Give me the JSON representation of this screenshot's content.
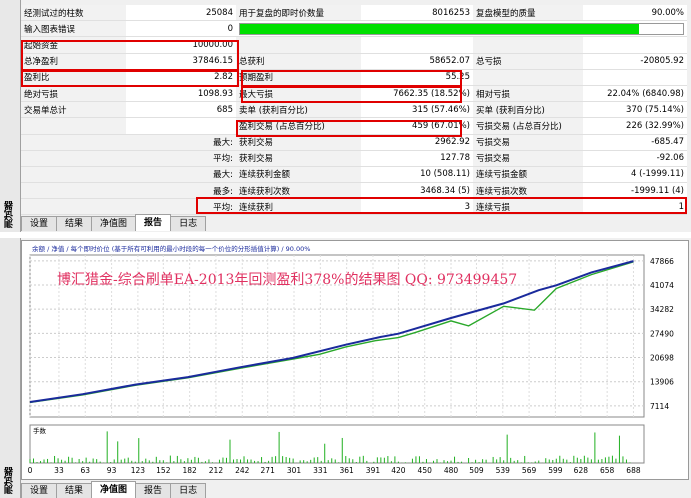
{
  "report": {
    "rows": [
      [
        "经测试过的柱数",
        "25084",
        "用于复盘的即时价数量",
        "8016253",
        "复盘模型的质量",
        "90.00%"
      ],
      [
        "输入图表错误",
        "0",
        "",
        "",
        "",
        ""
      ],
      [
        "起始资金",
        "10000.00",
        "",
        "",
        "",
        ""
      ],
      [
        "总净盈利",
        "37846.15",
        "总获利",
        "58652.07",
        "总亏损",
        "-20805.92"
      ],
      [
        "盈利比",
        "2.82",
        "预期盈利",
        "55.25",
        "",
        ""
      ],
      [
        "绝对亏损",
        "1098.93",
        "最大亏损",
        "7662.35 (18.52%)",
        "相对亏损",
        "22.04% (6840.98)"
      ],
      [
        "交易单总计",
        "685",
        "卖单 (获利百分比)",
        "315 (57.46%)",
        "买单 (获利百分比)",
        "370 (75.14%)"
      ],
      [
        "",
        "",
        "盈利交易 (占总百分比)",
        "459 (67.01%)",
        "亏损交易 (占总百分比)",
        "226 (32.99%)"
      ],
      [
        "",
        "最大:",
        "获利交易",
        "2962.92",
        "亏损交易",
        "-685.47"
      ],
      [
        "",
        "平均:",
        "获利交易",
        "127.78",
        "亏损交易",
        "-92.06"
      ],
      [
        "",
        "最大:",
        "连续获利金额",
        "10 (508.11)",
        "连续亏损金额",
        "4 (-1999.11)"
      ],
      [
        "",
        "最多:",
        "连续获利次数",
        "3468.34 (5)",
        "连续亏损次数",
        "-1999.11 (4)"
      ],
      [
        "",
        "平均:",
        "连续获利",
        "3",
        "连续亏损",
        "1"
      ]
    ],
    "quality_fraction": 0.9
  },
  "sidebar_label": "测试器",
  "tabs_top": [
    {
      "label": "设置",
      "active": false
    },
    {
      "label": "结果",
      "active": false
    },
    {
      "label": "净值图",
      "active": false
    },
    {
      "label": "报告",
      "active": true
    },
    {
      "label": "日志",
      "active": false
    }
  ],
  "tabs_bottom": [
    {
      "label": "设置",
      "active": false
    },
    {
      "label": "结果",
      "active": false
    },
    {
      "label": "净值图",
      "active": true
    },
    {
      "label": "报告",
      "active": false
    },
    {
      "label": "日志",
      "active": false
    }
  ],
  "chart_header": "余额 / 净值 / 每个即时价位 (基于所有可利用的最小时段的每一个价位的分形插值计算) / 90.00%",
  "overlay_title": "博汇猎金-综合刷单EA-2013年回测盈利378%的结果图   QQ: 973499457",
  "volume_label": "手数",
  "colors": {
    "balance": "#1a2a9c",
    "equity": "#2aa82a",
    "volume": "#20b020",
    "highlight": "#e00000",
    "quality": "#00e000"
  },
  "chart_data": {
    "type": "line",
    "y_ticks": [
      7114,
      13906,
      20698,
      27490,
      34282,
      41074,
      47866
    ],
    "x_ticks": [
      0,
      33,
      63,
      93,
      123,
      152,
      182,
      212,
      242,
      271,
      301,
      331,
      361,
      391,
      420,
      450,
      480,
      509,
      539,
      569,
      599,
      628,
      658,
      688
    ],
    "ylim": [
      4000,
      49500
    ],
    "xlim": [
      0,
      700
    ],
    "series": [
      {
        "name": "余额",
        "values": [
          [
            0,
            8200
          ],
          [
            60,
            10400
          ],
          [
            120,
            13100
          ],
          [
            180,
            15200
          ],
          [
            240,
            18000
          ],
          [
            300,
            20600
          ],
          [
            360,
            24300
          ],
          [
            400,
            26500
          ],
          [
            420,
            27400
          ],
          [
            480,
            31800
          ],
          [
            540,
            35900
          ],
          [
            580,
            39600
          ],
          [
            600,
            41000
          ],
          [
            640,
            44600
          ],
          [
            688,
            47800
          ]
        ]
      },
      {
        "name": "净值",
        "values": [
          [
            0,
            8100
          ],
          [
            60,
            10200
          ],
          [
            120,
            12900
          ],
          [
            180,
            15000
          ],
          [
            240,
            17700
          ],
          [
            300,
            20300
          ],
          [
            330,
            21600
          ],
          [
            360,
            23700
          ],
          [
            395,
            25500
          ],
          [
            420,
            26300
          ],
          [
            440,
            27800
          ],
          [
            480,
            31000
          ],
          [
            500,
            29600
          ],
          [
            540,
            35100
          ],
          [
            575,
            34000
          ],
          [
            600,
            40100
          ],
          [
            640,
            44000
          ],
          [
            688,
            47600
          ]
        ]
      }
    ]
  }
}
